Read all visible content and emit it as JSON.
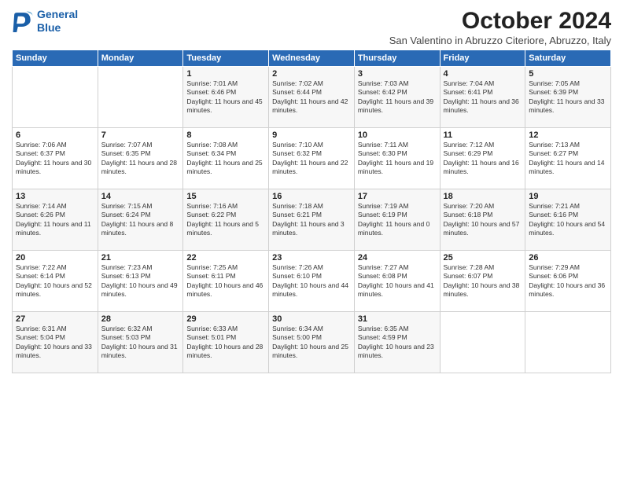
{
  "logo": {
    "line1": "General",
    "line2": "Blue"
  },
  "title": "October 2024",
  "subtitle": "San Valentino in Abruzzo Citeriore, Abruzzo, Italy",
  "header_days": [
    "Sunday",
    "Monday",
    "Tuesday",
    "Wednesday",
    "Thursday",
    "Friday",
    "Saturday"
  ],
  "weeks": [
    [
      {
        "day": "",
        "info": ""
      },
      {
        "day": "",
        "info": ""
      },
      {
        "day": "1",
        "info": "Sunrise: 7:01 AM\nSunset: 6:46 PM\nDaylight: 11 hours and 45 minutes."
      },
      {
        "day": "2",
        "info": "Sunrise: 7:02 AM\nSunset: 6:44 PM\nDaylight: 11 hours and 42 minutes."
      },
      {
        "day": "3",
        "info": "Sunrise: 7:03 AM\nSunset: 6:42 PM\nDaylight: 11 hours and 39 minutes."
      },
      {
        "day": "4",
        "info": "Sunrise: 7:04 AM\nSunset: 6:41 PM\nDaylight: 11 hours and 36 minutes."
      },
      {
        "day": "5",
        "info": "Sunrise: 7:05 AM\nSunset: 6:39 PM\nDaylight: 11 hours and 33 minutes."
      }
    ],
    [
      {
        "day": "6",
        "info": "Sunrise: 7:06 AM\nSunset: 6:37 PM\nDaylight: 11 hours and 30 minutes."
      },
      {
        "day": "7",
        "info": "Sunrise: 7:07 AM\nSunset: 6:35 PM\nDaylight: 11 hours and 28 minutes."
      },
      {
        "day": "8",
        "info": "Sunrise: 7:08 AM\nSunset: 6:34 PM\nDaylight: 11 hours and 25 minutes."
      },
      {
        "day": "9",
        "info": "Sunrise: 7:10 AM\nSunset: 6:32 PM\nDaylight: 11 hours and 22 minutes."
      },
      {
        "day": "10",
        "info": "Sunrise: 7:11 AM\nSunset: 6:30 PM\nDaylight: 11 hours and 19 minutes."
      },
      {
        "day": "11",
        "info": "Sunrise: 7:12 AM\nSunset: 6:29 PM\nDaylight: 11 hours and 16 minutes."
      },
      {
        "day": "12",
        "info": "Sunrise: 7:13 AM\nSunset: 6:27 PM\nDaylight: 11 hours and 14 minutes."
      }
    ],
    [
      {
        "day": "13",
        "info": "Sunrise: 7:14 AM\nSunset: 6:26 PM\nDaylight: 11 hours and 11 minutes."
      },
      {
        "day": "14",
        "info": "Sunrise: 7:15 AM\nSunset: 6:24 PM\nDaylight: 11 hours and 8 minutes."
      },
      {
        "day": "15",
        "info": "Sunrise: 7:16 AM\nSunset: 6:22 PM\nDaylight: 11 hours and 5 minutes."
      },
      {
        "day": "16",
        "info": "Sunrise: 7:18 AM\nSunset: 6:21 PM\nDaylight: 11 hours and 3 minutes."
      },
      {
        "day": "17",
        "info": "Sunrise: 7:19 AM\nSunset: 6:19 PM\nDaylight: 11 hours and 0 minutes."
      },
      {
        "day": "18",
        "info": "Sunrise: 7:20 AM\nSunset: 6:18 PM\nDaylight: 10 hours and 57 minutes."
      },
      {
        "day": "19",
        "info": "Sunrise: 7:21 AM\nSunset: 6:16 PM\nDaylight: 10 hours and 54 minutes."
      }
    ],
    [
      {
        "day": "20",
        "info": "Sunrise: 7:22 AM\nSunset: 6:14 PM\nDaylight: 10 hours and 52 minutes."
      },
      {
        "day": "21",
        "info": "Sunrise: 7:23 AM\nSunset: 6:13 PM\nDaylight: 10 hours and 49 minutes."
      },
      {
        "day": "22",
        "info": "Sunrise: 7:25 AM\nSunset: 6:11 PM\nDaylight: 10 hours and 46 minutes."
      },
      {
        "day": "23",
        "info": "Sunrise: 7:26 AM\nSunset: 6:10 PM\nDaylight: 10 hours and 44 minutes."
      },
      {
        "day": "24",
        "info": "Sunrise: 7:27 AM\nSunset: 6:08 PM\nDaylight: 10 hours and 41 minutes."
      },
      {
        "day": "25",
        "info": "Sunrise: 7:28 AM\nSunset: 6:07 PM\nDaylight: 10 hours and 38 minutes."
      },
      {
        "day": "26",
        "info": "Sunrise: 7:29 AM\nSunset: 6:06 PM\nDaylight: 10 hours and 36 minutes."
      }
    ],
    [
      {
        "day": "27",
        "info": "Sunrise: 6:31 AM\nSunset: 5:04 PM\nDaylight: 10 hours and 33 minutes."
      },
      {
        "day": "28",
        "info": "Sunrise: 6:32 AM\nSunset: 5:03 PM\nDaylight: 10 hours and 31 minutes."
      },
      {
        "day": "29",
        "info": "Sunrise: 6:33 AM\nSunset: 5:01 PM\nDaylight: 10 hours and 28 minutes."
      },
      {
        "day": "30",
        "info": "Sunrise: 6:34 AM\nSunset: 5:00 PM\nDaylight: 10 hours and 25 minutes."
      },
      {
        "day": "31",
        "info": "Sunrise: 6:35 AM\nSunset: 4:59 PM\nDaylight: 10 hours and 23 minutes."
      },
      {
        "day": "",
        "info": ""
      },
      {
        "day": "",
        "info": ""
      }
    ]
  ]
}
